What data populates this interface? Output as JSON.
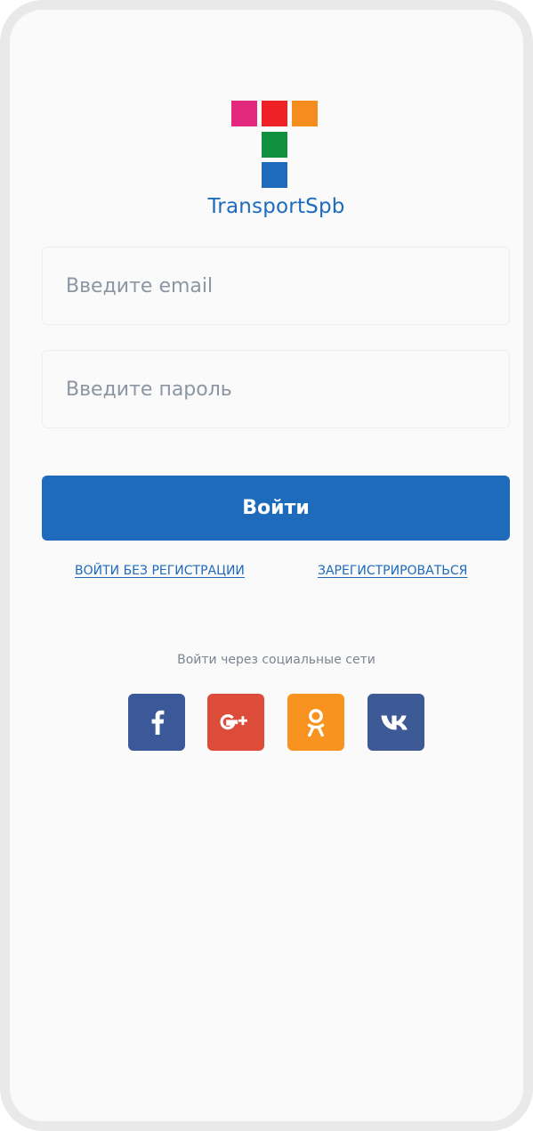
{
  "app": {
    "name": "TransportSpb"
  },
  "colors": {
    "accent": "#1e6bbb",
    "logo_magenta": "#e2297e",
    "logo_red": "#ee2224",
    "logo_orange": "#f58c1e",
    "logo_green": "#119040",
    "logo_blue": "#1e6bbb",
    "facebook": "#3b5998",
    "google_plus": "#dd4b39",
    "odnoklassniki": "#f7931e",
    "vkontakte": "#3e5a96"
  },
  "form": {
    "email": {
      "value": "",
      "placeholder": "Введите email"
    },
    "password": {
      "value": "",
      "placeholder": "Введите пароль"
    },
    "submit_label": "Войти"
  },
  "links": {
    "guest_label": "ВОЙТИ БЕЗ РЕГИСТРАЦИИ",
    "register_label": "ЗАРЕГИСТРИРОВАТЬСЯ"
  },
  "social": {
    "caption": "Войти через социальные сети",
    "buttons": [
      {
        "icon": "facebook-icon",
        "label": "f"
      },
      {
        "icon": "google-plus-icon",
        "label": "G+"
      },
      {
        "icon": "odnoklassniki-icon",
        "label": ""
      },
      {
        "icon": "vk-icon",
        "label": "vk"
      }
    ]
  }
}
